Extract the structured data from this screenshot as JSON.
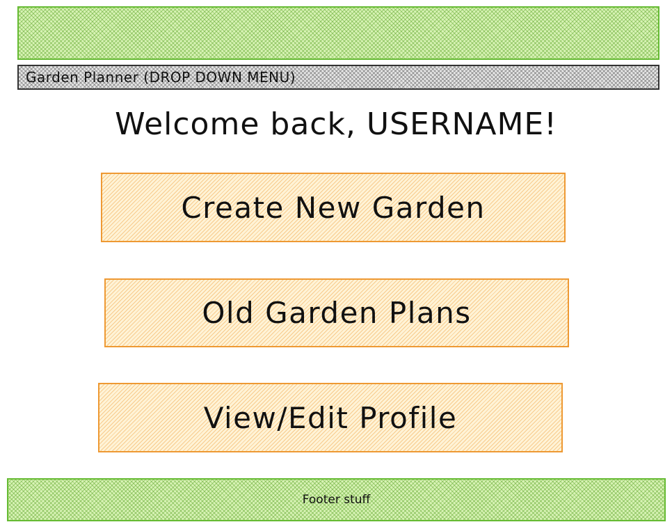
{
  "header": {
    "nav_label": "Garden Planner (DROP DOWN MENU)"
  },
  "main": {
    "welcome": "Welcome back, USERNAME!",
    "buttons": [
      {
        "label": "Create New Garden"
      },
      {
        "label": "Old Garden Plans"
      },
      {
        "label": "View/Edit Profile"
      }
    ]
  },
  "footer": {
    "text": "Footer stuff"
  },
  "colors": {
    "banner_green": "#66bb33",
    "button_orange": "#ee9933",
    "nav_grey": "#333333"
  }
}
